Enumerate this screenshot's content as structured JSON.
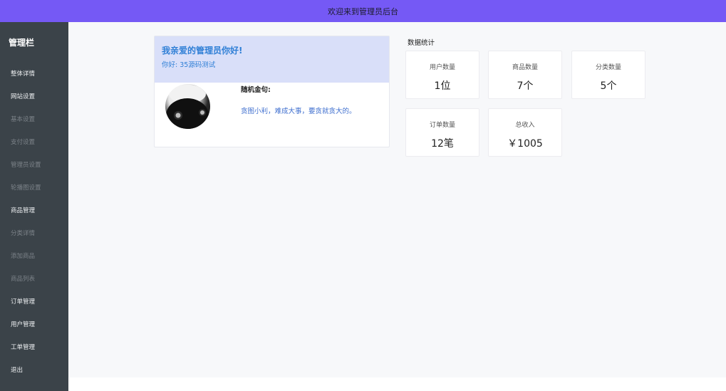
{
  "topbar": {
    "title": "欢迎来到管理员后台"
  },
  "sidebar": {
    "title": "管理栏",
    "items": [
      {
        "label": "整体详情",
        "kind": "main"
      },
      {
        "label": "网站设置",
        "kind": "main"
      },
      {
        "label": "基本设置",
        "kind": "sub"
      },
      {
        "label": "支付设置",
        "kind": "sub"
      },
      {
        "label": "管理员设置",
        "kind": "sub"
      },
      {
        "label": "轮播图设置",
        "kind": "sub"
      },
      {
        "label": "商品管理",
        "kind": "main"
      },
      {
        "label": "分类详情",
        "kind": "sub"
      },
      {
        "label": "添加商品",
        "kind": "sub"
      },
      {
        "label": "商品列表",
        "kind": "sub"
      },
      {
        "label": "订单管理",
        "kind": "main"
      },
      {
        "label": "用户管理",
        "kind": "main"
      },
      {
        "label": "工单管理",
        "kind": "main"
      },
      {
        "label": "退出",
        "kind": "main"
      }
    ]
  },
  "welcome": {
    "title": "我亲爱的管理员你好!",
    "greeting": "你好: 35源码测试",
    "quote_label": "随机金句:",
    "quote": "贪图小利，难成大事，要贪就贪大的。"
  },
  "stats": {
    "title": "数据统计",
    "cards": [
      {
        "label": "用户数量",
        "value": "1位"
      },
      {
        "label": "商品数量",
        "value": "7个"
      },
      {
        "label": "分类数量",
        "value": "5个"
      },
      {
        "label": "订单数量",
        "value": "12笔"
      },
      {
        "label": "总收入",
        "value": "￥1005"
      }
    ]
  },
  "colors": {
    "topbar": "#7559f5",
    "sidebar": "#3b4349",
    "welcome_header": "#d9dff9",
    "accent_blue": "#2f7fd6"
  }
}
